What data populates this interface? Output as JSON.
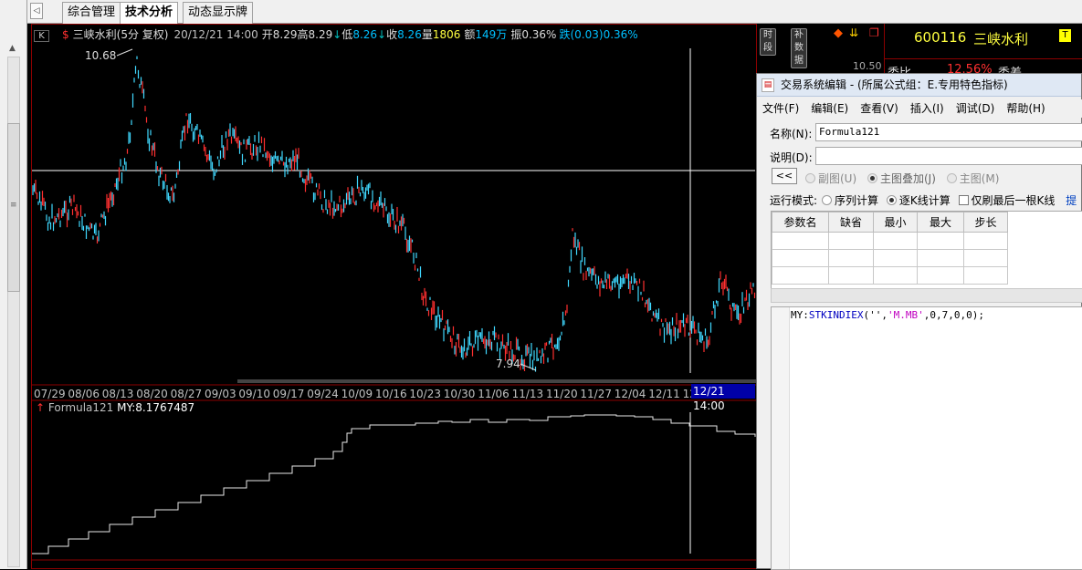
{
  "tabs": [
    {
      "label": "综合管理"
    },
    {
      "label": "技术分析"
    },
    {
      "label": "动态显示牌"
    }
  ],
  "header": {
    "k_label": "K",
    "dollar": "$",
    "name_period": "三峡水利(5分 复权)",
    "datetime": "20/12/21 14:00",
    "open_label": "开",
    "open": "8.29",
    "high_label": "高",
    "high": "8.29",
    "low_label": "低",
    "low": "8.26",
    "close_label": "收",
    "close": "8.26",
    "vol_label": "量",
    "vol": "1806",
    "amt_label": "额",
    "amt": "149万",
    "amp_label": "振",
    "amp": "0.36%",
    "chg_label": "跌",
    "chg": "(0.03)",
    "chg_pct": "0.36%",
    "btn_timeshare": "时段",
    "btn_supp": "补数据"
  },
  "quote": {
    "code": "600116",
    "name": "三峡水利",
    "price_hint": "10.50",
    "ratio_label": "委比",
    "ratio_value": "12.56%",
    "diff_label": "委差",
    "flag": "T"
  },
  "price_chart": {
    "high_label": "10.68",
    "low_label": "7.94",
    "dates": [
      "07/29",
      "08/06",
      "08/13",
      "08/20",
      "08/27",
      "09/03",
      "09/10",
      "09/17",
      "09/24",
      "10/09",
      "10/16",
      "10/23",
      "10/30",
      "11/06",
      "11/13",
      "11/20",
      "11/27",
      "12/04",
      "12/11",
      "12"
    ],
    "cursor_time": "12/21 14:00"
  },
  "indicator": {
    "name": "Formula121",
    "value_label": "MY:8.1767487"
  },
  "dialog": {
    "title": "交易系统编辑 - (所属公式组：E.专用特色指标)",
    "menu": [
      "文件(F)",
      "编辑(E)",
      "查看(V)",
      "插入(I)",
      "调试(D)",
      "帮助(H)"
    ],
    "name_label": "名称(N):",
    "name_value": "Formula121",
    "desc_label": "说明(D):",
    "desc_value": "",
    "collapse_btn": "<<",
    "chart_opts": [
      "副图(U)",
      "主图叠加(J)",
      "主图(M)"
    ],
    "mode_label": "运行模式:",
    "mode_opts": [
      "序列计算",
      "逐K线计算"
    ],
    "only_last": "仅刷最后一根K线",
    "submit": "提",
    "param_headers": [
      "参数名",
      "缺省",
      "最小",
      "最大",
      "步长"
    ],
    "code_line_parts": {
      "a": "MY:",
      "b": "STKINDIEX",
      "c": "('',",
      "d": "'M.MB'",
      "e": ",0,7,0,0);"
    }
  }
}
